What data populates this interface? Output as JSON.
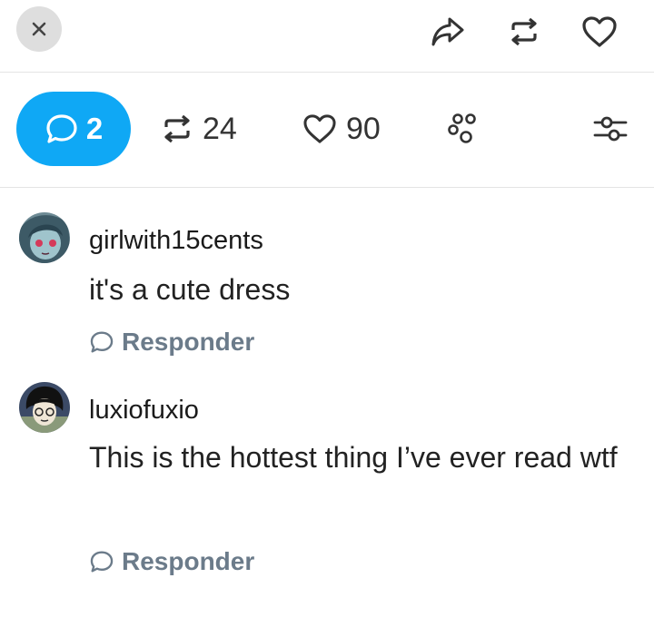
{
  "top_bar": {
    "close_icon": "close-icon",
    "share_icon": "share-icon",
    "reblog_icon": "reblog-icon",
    "like_icon": "heart-icon"
  },
  "stats": {
    "comments_count": "2",
    "reblogs_count": "24",
    "likes_count": "90",
    "accent": "#0fa8f5"
  },
  "comments": [
    {
      "username": "girlwith15cents",
      "text": "it's a cute dress",
      "reply_label": "Responder"
    },
    {
      "username": "luxiofuxio",
      "text": "This is the hottest thing I’ve ever read wtf",
      "reply_label": "Responder"
    }
  ]
}
